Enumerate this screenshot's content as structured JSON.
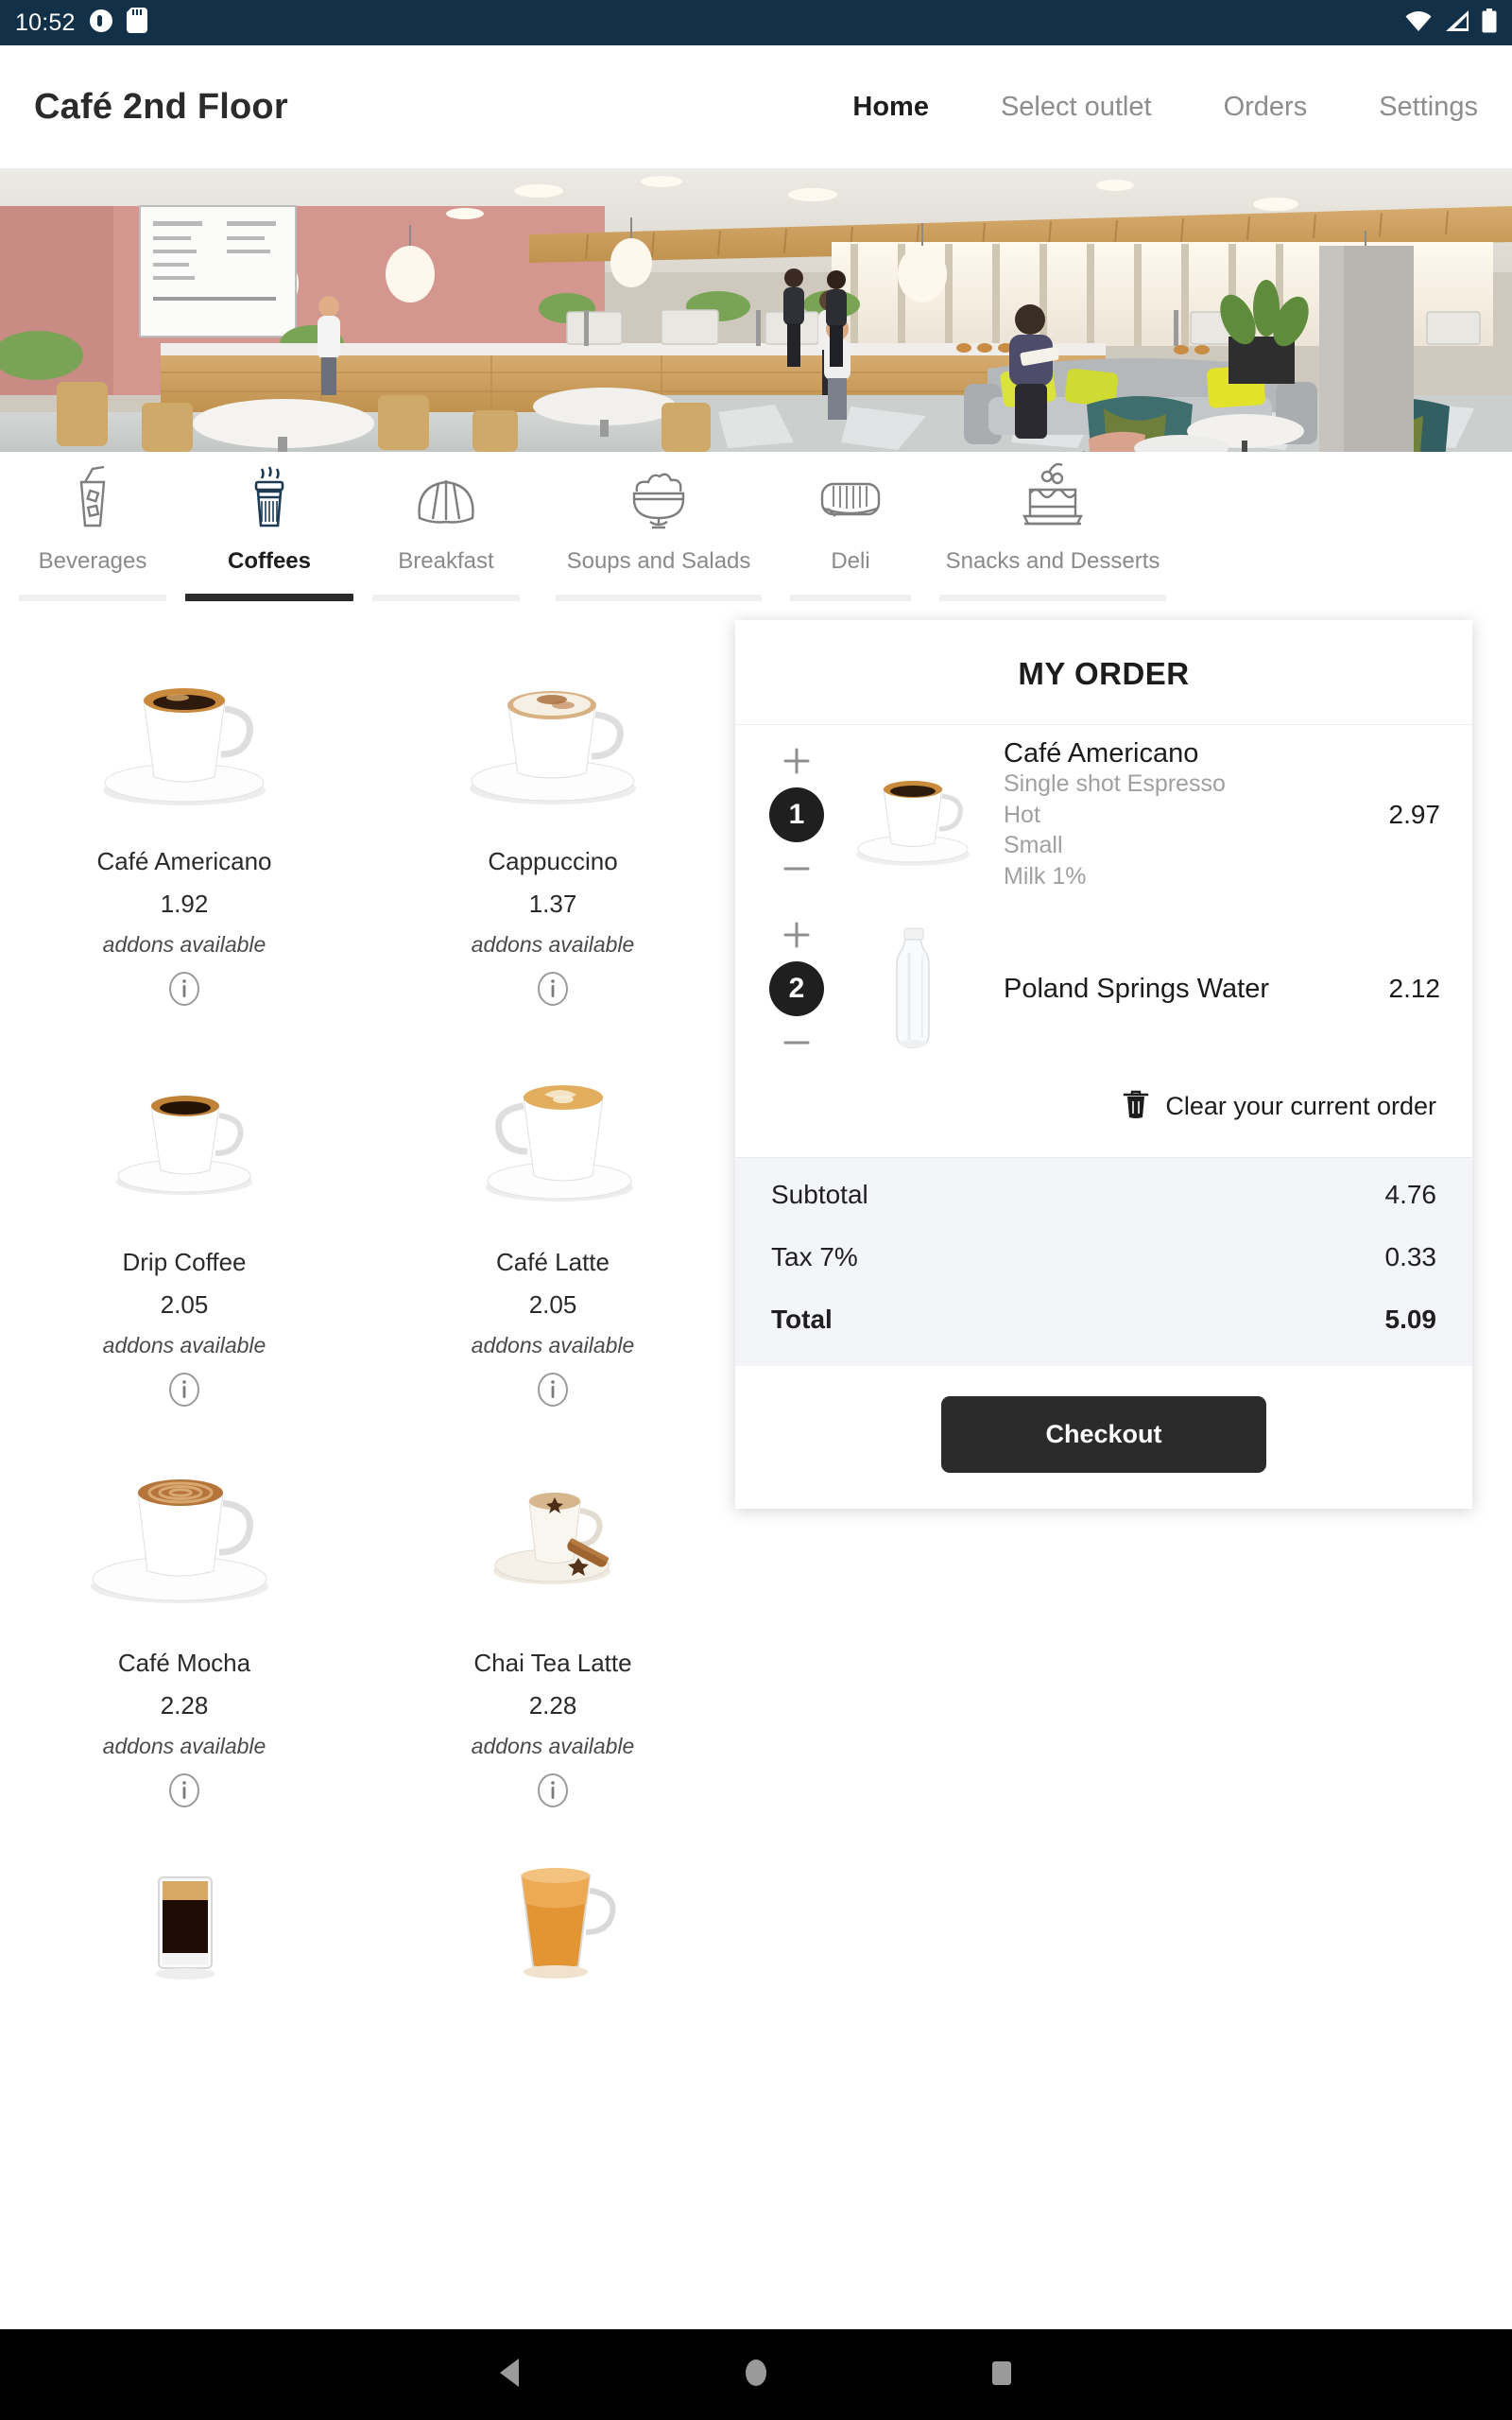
{
  "status_bar": {
    "time": "10:52",
    "left_icons": [
      "camera-icon",
      "sd-card-icon"
    ],
    "right_icons": [
      "wifi-icon",
      "cellular-signal-icon",
      "battery-icon"
    ],
    "background": "#123048"
  },
  "header": {
    "brand": "Café 2nd Floor",
    "nav": [
      {
        "label": "Home",
        "active": true
      },
      {
        "label": "Select outlet",
        "active": false
      },
      {
        "label": "Orders",
        "active": false
      },
      {
        "label": "Settings",
        "active": false
      }
    ]
  },
  "hero": {
    "alt": "cafe-interior-photo"
  },
  "categories": [
    {
      "label": "Beverages",
      "icon": "iced-drink-icon",
      "active": false
    },
    {
      "label": "Coffees",
      "icon": "coffee-cup-icon",
      "active": true
    },
    {
      "label": "Breakfast",
      "icon": "croissant-icon",
      "active": false
    },
    {
      "label": "Soups and Salads",
      "icon": "salad-bowl-icon",
      "active": false
    },
    {
      "label": "Deli",
      "icon": "sandwich-icon",
      "active": false
    },
    {
      "label": "Snacks and Desserts",
      "icon": "cake-icon",
      "active": false
    }
  ],
  "products": [
    {
      "name": "Café Americano",
      "price": "1.92",
      "addons": "addons available",
      "image": "americano-cup"
    },
    {
      "name": "Cappuccino",
      "price": "1.37",
      "addons": "addons available",
      "image": "cappuccino-cup"
    },
    {
      "name": "Drip Coffee",
      "price": "2.05",
      "addons": "addons available",
      "image": "drip-coffee-cup"
    },
    {
      "name": "Café Latte",
      "price": "2.05",
      "addons": "addons available",
      "image": "latte-cup"
    },
    {
      "name": "Café Mocha",
      "price": "2.28",
      "addons": "addons available",
      "image": "mocha-cup"
    },
    {
      "name": "Chai Tea Latte",
      "price": "2.28",
      "addons": "addons available",
      "image": "chai-latte-cup"
    },
    {
      "name": "",
      "price": "",
      "addons": "",
      "image": "espresso-glass"
    },
    {
      "name": "",
      "price": "",
      "addons": "",
      "image": "tea-glass"
    }
  ],
  "order": {
    "title": "MY ORDER",
    "items": [
      {
        "qty": "1",
        "name": "Café Americano",
        "options": [
          "Single shot Espresso",
          "Hot",
          "Small",
          "Milk 1%"
        ],
        "price": "2.97",
        "image": "americano-cup"
      },
      {
        "qty": "2",
        "name": "Poland Springs Water",
        "options": [],
        "price": "2.12",
        "image": "water-bottle"
      }
    ],
    "clear_label": "Clear your current order",
    "totals": [
      {
        "label": "Subtotal",
        "value": "4.76",
        "grand": false
      },
      {
        "label": "Tax 7%",
        "value": "0.33",
        "grand": false
      },
      {
        "label": "Total",
        "value": "5.09",
        "grand": true
      }
    ],
    "checkout_label": "Checkout"
  },
  "navbar": {
    "buttons": [
      "back-triangle-icon",
      "home-circle-icon",
      "recents-square-icon"
    ]
  },
  "colors": {
    "status_bar": "#123048",
    "accent_dark": "#2b2b2b",
    "totals_bg": "#f3f5f8",
    "muted_text": "#8d8d8d"
  }
}
